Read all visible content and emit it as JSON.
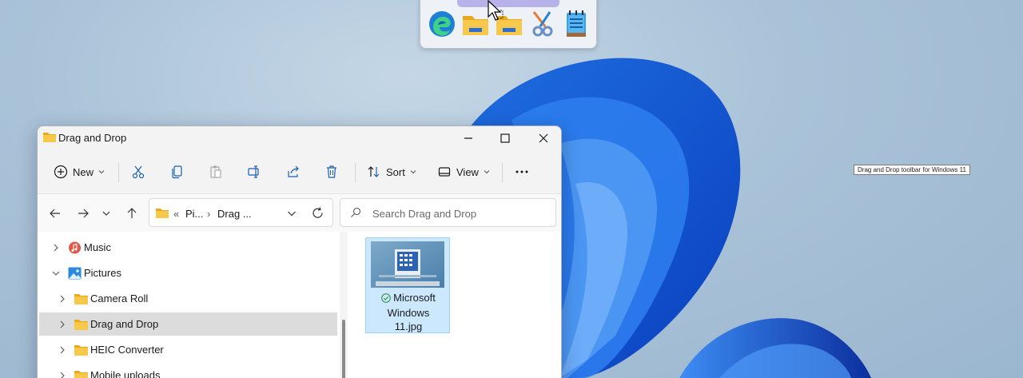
{
  "tooltip": "Drag and Drop toolbar for Windows 11",
  "dock": {
    "apps": [
      {
        "name": "edge",
        "icon": "edge-icon"
      },
      {
        "name": "folder",
        "icon": "folder-icon"
      },
      {
        "name": "folder",
        "icon": "folder-icon"
      },
      {
        "name": "snipping-tool",
        "icon": "scissors-icon"
      },
      {
        "name": "notepad",
        "icon": "notepad-icon"
      }
    ]
  },
  "window": {
    "title": "Drag and Drop",
    "commands": {
      "new_label": "New",
      "sort_label": "Sort",
      "view_label": "View"
    },
    "address": {
      "separator": "«",
      "segment1": "Pi...",
      "arrow": "›",
      "segment2": "Drag ..."
    },
    "search": {
      "placeholder": "Search Drag and Drop"
    },
    "tree": [
      {
        "label": "Music",
        "expanded": false
      },
      {
        "label": "Pictures",
        "expanded": true
      },
      {
        "label": "Camera Roll",
        "expanded": false
      },
      {
        "label": "Drag and Drop",
        "expanded": false,
        "selected": true
      },
      {
        "label": "HEIC Converter",
        "expanded": false
      },
      {
        "label": "Mobile uploads",
        "expanded": false
      }
    ],
    "files": [
      {
        "line1": "Microsoft",
        "line2": "Windows",
        "line3": "11.jpg"
      }
    ]
  },
  "colors": {
    "accent": "#0067c0",
    "selection": "#cce8ff",
    "folder": "#f4c542"
  }
}
